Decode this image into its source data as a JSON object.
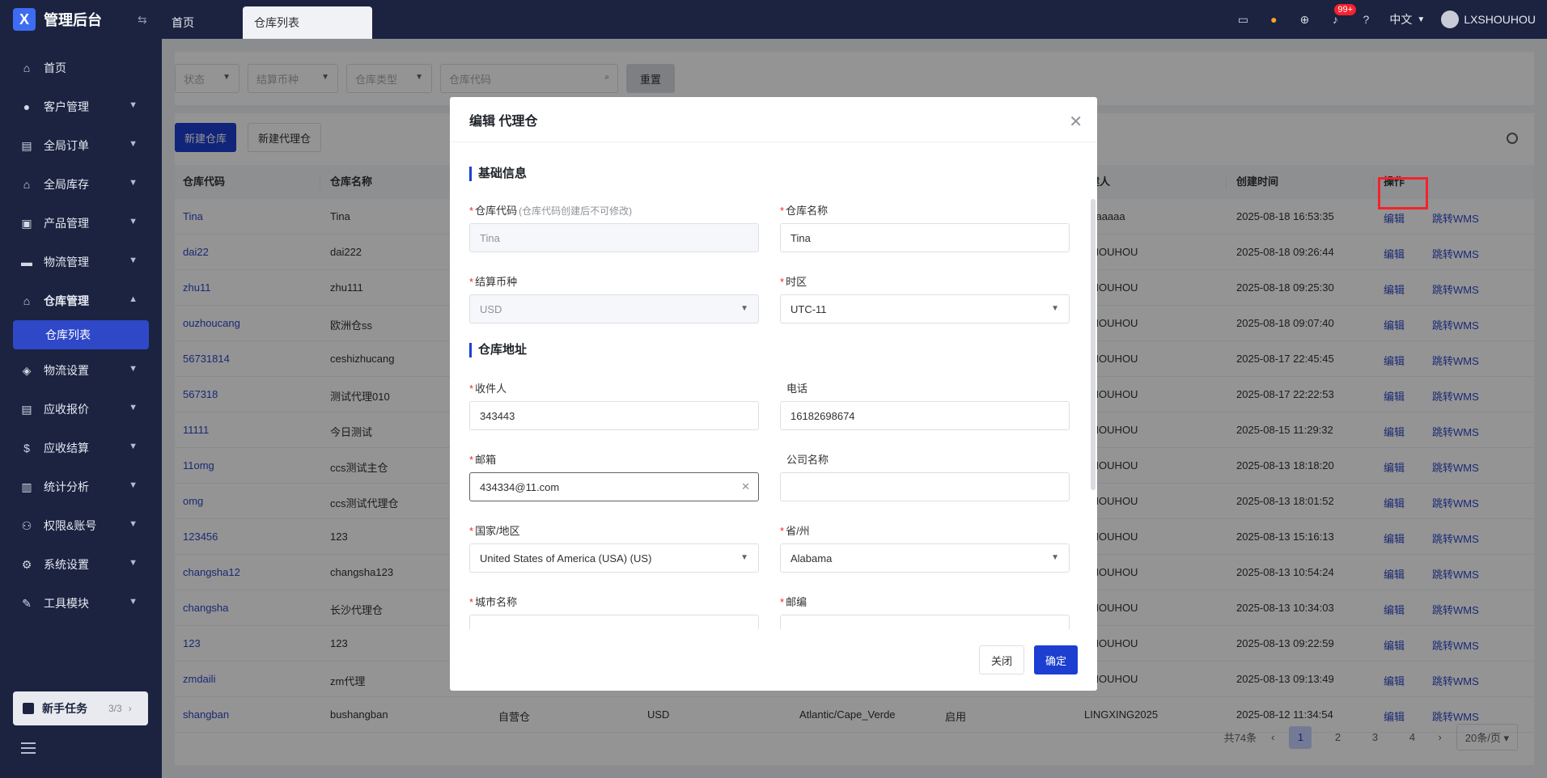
{
  "app": {
    "title": "管理后台",
    "logo_letter": "X"
  },
  "sidebar": {
    "items": [
      {
        "label": "首页",
        "icon": "home-icon"
      },
      {
        "label": "客户管理",
        "icon": "users-icon"
      },
      {
        "label": "全局订单",
        "icon": "clipboard-icon"
      },
      {
        "label": "全局库存",
        "icon": "warehouse-icon"
      },
      {
        "label": "产品管理",
        "icon": "box-icon"
      },
      {
        "label": "物流管理",
        "icon": "truck-icon"
      },
      {
        "label": "仓库管理",
        "icon": "warehouse-icon"
      },
      {
        "label": "物流设置",
        "icon": "package-icon"
      },
      {
        "label": "应收报价",
        "icon": "document-icon"
      },
      {
        "label": "应收结算",
        "icon": "dollar-icon"
      },
      {
        "label": "统计分析",
        "icon": "chart-icon"
      },
      {
        "label": "权限&账号",
        "icon": "org-icon"
      },
      {
        "label": "系统设置",
        "icon": "gear-icon"
      },
      {
        "label": "工具模块",
        "icon": "tool-icon"
      }
    ],
    "active_sub": "仓库列表",
    "task": {
      "label": "新手任务",
      "count": "3/3"
    }
  },
  "tabs": [
    {
      "label": "首页"
    },
    {
      "label": "仓库列表"
    }
  ],
  "topbar": {
    "badge": "99+",
    "language": "中文",
    "user": "LXSHOUHOU"
  },
  "filters": {
    "status": "状态",
    "currency": "结算币种",
    "type": "仓库类型",
    "code_placeholder": "仓库代码",
    "reset": "重置"
  },
  "actions": {
    "new_warehouse": "新建仓库",
    "new_agent": "新建代理仓"
  },
  "table": {
    "headers": [
      "仓库代码",
      "仓库名称",
      "建人",
      "创建时间",
      "操作"
    ],
    "rows": [
      {
        "code": "Tina",
        "name": "Tina",
        "creator": "haaaaaa",
        "time": "2025-08-18 16:53:35"
      },
      {
        "code": "dai22",
        "name": "dai222",
        "creator": "SHOUHOU",
        "time": "2025-08-18 09:26:44"
      },
      {
        "code": "zhu11",
        "name": "zhu111",
        "creator": "SHOUHOU",
        "time": "2025-08-18 09:25:30"
      },
      {
        "code": "ouzhoucang",
        "name": "欧洲仓ss",
        "creator": "SHOUHOU",
        "time": "2025-08-18 09:07:40"
      },
      {
        "code": "56731814",
        "name": "ceshizhucang",
        "creator": "SHOUHOU",
        "time": "2025-08-17 22:45:45"
      },
      {
        "code": "567318",
        "name": "测试代理010",
        "creator": "SHOUHOU",
        "time": "2025-08-17 22:22:53"
      },
      {
        "code": "11111",
        "name": "今日测试",
        "creator": "SHOUHOU",
        "time": "2025-08-15 11:29:32"
      },
      {
        "code": "11omg",
        "name": "ccs测试主仓",
        "creator": "SHOUHOU",
        "time": "2025-08-13 18:18:20"
      },
      {
        "code": "omg",
        "name": "ccs测试代理仓",
        "creator": "SHOUHOU",
        "time": "2025-08-13 18:01:52"
      },
      {
        "code": "123456",
        "name": "123",
        "creator": "SHOUHOU",
        "time": "2025-08-13 15:16:13"
      },
      {
        "code": "changsha12",
        "name": "changsha123",
        "creator": "SHOUHOU",
        "time": "2025-08-13 10:54:24"
      },
      {
        "code": "changsha",
        "name": "长沙代理仓",
        "creator": "SHOUHOU",
        "time": "2025-08-13 10:34:03"
      },
      {
        "code": "123",
        "name": "123",
        "creator": "SHOUHOU",
        "time": "2025-08-13 09:22:59"
      },
      {
        "code": "zmdaili",
        "name": "zm代理",
        "creator": "SHOUHOU",
        "time": "2025-08-13 09:13:49"
      },
      {
        "code": "shangban",
        "name": "bushangban",
        "type": "自营仓",
        "currency": "USD",
        "tz": "Atlantic/Cape_Verde",
        "status": "启用",
        "creator": "LINGXING2025",
        "time": "2025-08-12 11:34:54"
      }
    ],
    "edit": "编辑",
    "jump": "跳转WMS"
  },
  "pagination": {
    "total": "共74条",
    "pages": [
      "1",
      "2",
      "3",
      "4"
    ],
    "size": "20条/页"
  },
  "modal": {
    "title": "编辑 代理仓",
    "section_basic": "基础信息",
    "section_address": "仓库地址",
    "fields": {
      "code_label": "仓库代码",
      "code_hint": "(仓库代码创建后不可修改)",
      "code_value": "Tina",
      "name_label": "仓库名称",
      "name_value": "Tina",
      "currency_label": "结算币种",
      "currency_value": "USD",
      "tz_label": "时区",
      "tz_value": "UTC-11",
      "receiver_label": "收件人",
      "receiver_value": "343443",
      "phone_label": "电话",
      "phone_value": "16182698674",
      "email_label": "邮箱",
      "email_value": "434334@11.com",
      "company_label": "公司名称",
      "company_value": "",
      "country_label": "国家/地区",
      "country_value": "United States of America (USA) (US)",
      "state_label": "省/州",
      "state_value": "Alabama",
      "city_label": "城市名称",
      "zip_label": "邮编"
    },
    "close": "关闭",
    "confirm": "确定"
  }
}
